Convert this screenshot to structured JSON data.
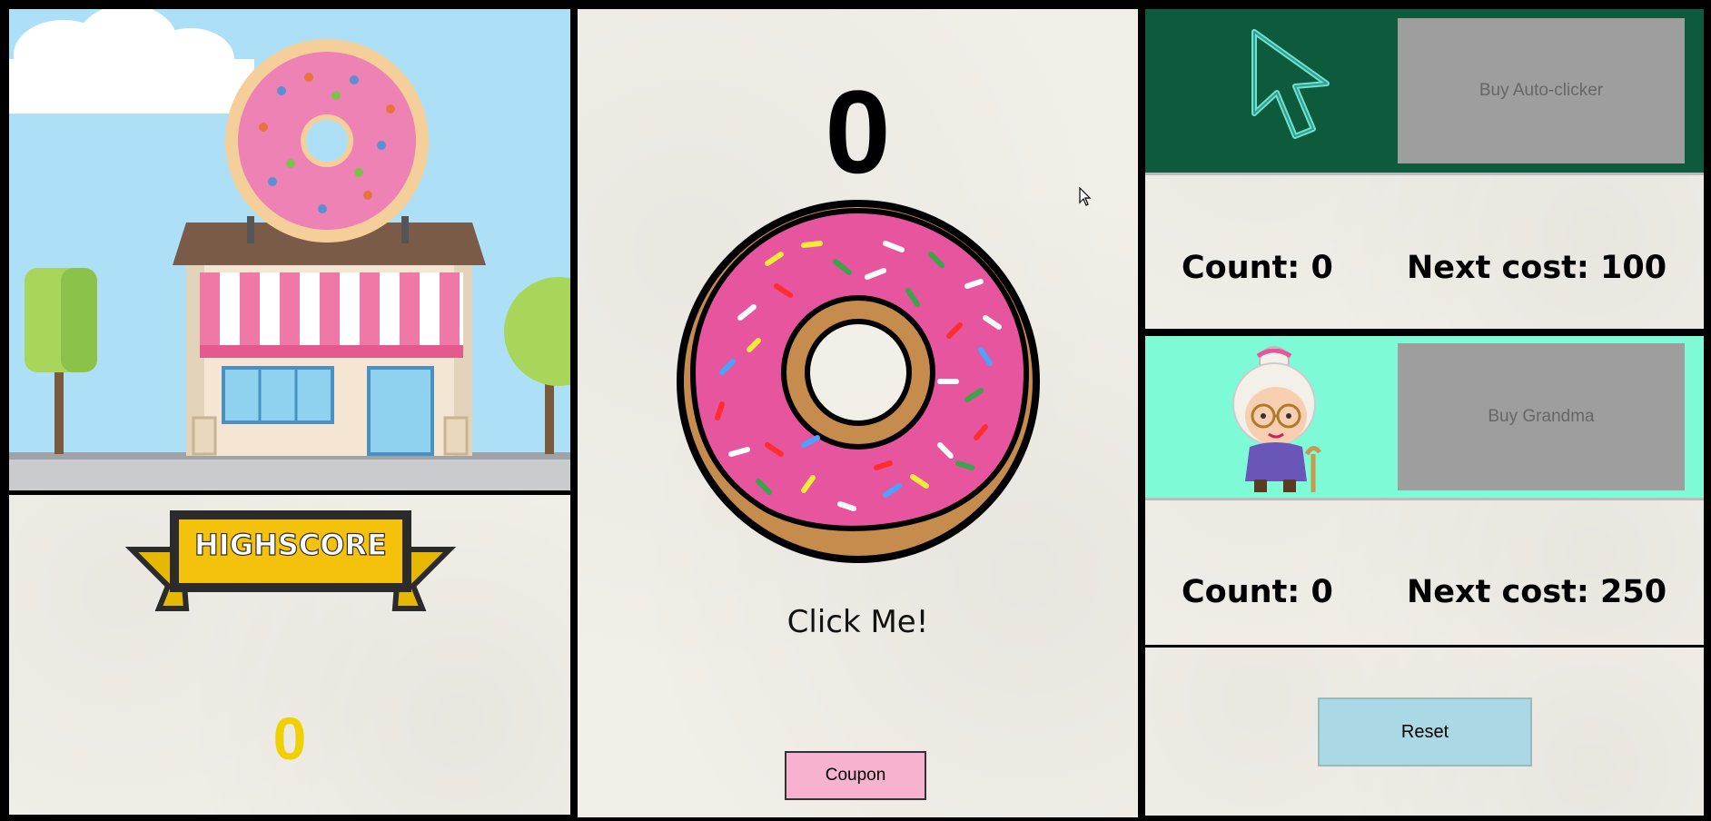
{
  "main": {
    "donut_count": "0",
    "click_prompt": "Click Me!",
    "coupon_label": "Coupon"
  },
  "highscore": {
    "banner_text": "HIGHSCORE",
    "value": "0"
  },
  "upgrades": {
    "auto_clicker": {
      "button_label": "Buy Auto-clicker",
      "count": "Count: 0",
      "next_cost": "Next cost: 100",
      "bg_color": "#0d5a3c"
    },
    "grandma": {
      "button_label": "Buy Grandma",
      "count": "Count: 0",
      "next_cost": "Next cost: 250",
      "bg_color": "#7ffad6"
    }
  },
  "reset_label": "Reset",
  "icons": [
    "shop-illustration",
    "highscore-banner",
    "donut-image",
    "cursor-icon",
    "grandma-image"
  ],
  "colors": {
    "highscore_value": "#f0d000",
    "coupon_button": "#f6b2cf",
    "reset_button": "#aad8e4",
    "buy_button": "#9e9e9e"
  }
}
